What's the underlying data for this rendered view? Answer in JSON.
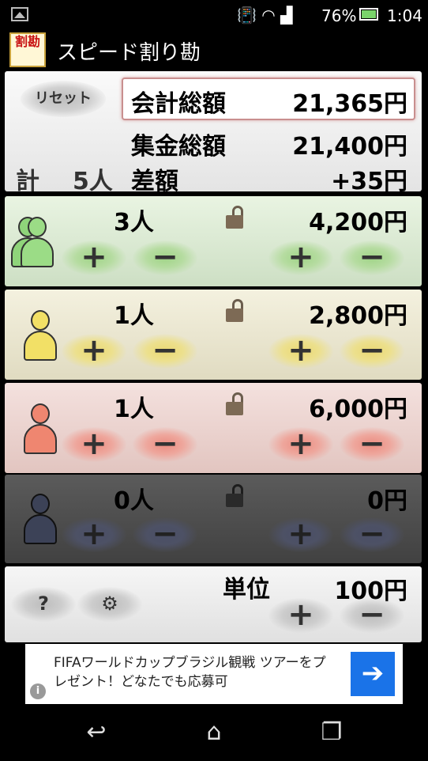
{
  "status": {
    "battery_pct": "76%",
    "time": "1:04"
  },
  "app": {
    "logo_text": "割勘",
    "title": "スピード割り勘"
  },
  "summary": {
    "reset_label": "リセット",
    "total_label": "会計総額",
    "total_value": "21,365円",
    "collected_label": "集金総額",
    "collected_value": "21,400円",
    "count_label": "計",
    "count_value": "5人",
    "diff_label": "差額",
    "diff_value": "+35円"
  },
  "groups": [
    {
      "people": "3人",
      "amount": "4,200円",
      "color": "#8fd47a",
      "locked": false
    },
    {
      "people": "1人",
      "amount": "2,800円",
      "color": "#f2e066",
      "locked": false
    },
    {
      "people": "1人",
      "amount": "6,000円",
      "color": "#ef8670",
      "locked": false
    },
    {
      "people": "0人",
      "amount": "0円",
      "color": "#3c4257",
      "locked": false
    }
  ],
  "buttons": {
    "plus": "+",
    "minus": "−"
  },
  "footer": {
    "help_label": "?",
    "settings_icon": "gear-icon",
    "unit_label": "単位",
    "unit_value": "100円"
  },
  "ad": {
    "text": "FIFAワールドカップブラジル観戦 ツアーをプレゼント！どなたでも応募可",
    "info": "i"
  }
}
